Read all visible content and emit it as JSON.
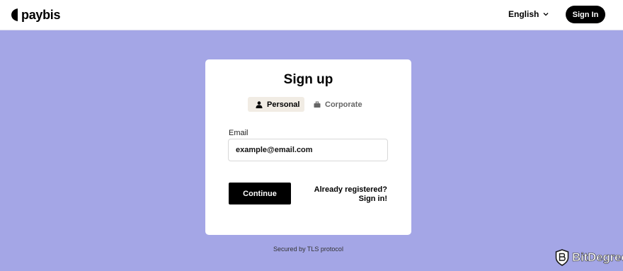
{
  "header": {
    "logo_text": "paybis",
    "language": "English",
    "sign_in_label": "Sign In"
  },
  "card": {
    "title": "Sign up",
    "tabs": [
      {
        "label": "Personal",
        "icon": "person-icon",
        "active": true
      },
      {
        "label": "Corporate",
        "icon": "briefcase-icon",
        "active": false
      }
    ],
    "email": {
      "label": "Email",
      "value": "example@email.com"
    },
    "continue_label": "Continue",
    "already_registered": "Already registered?",
    "sign_in_link": "Sign in!"
  },
  "footer": {
    "secured_text": "Secured by TLS protocol"
  },
  "watermark": {
    "text": "BitDegree"
  },
  "colors": {
    "background": "#a4a6e6",
    "primary_button": "#000000",
    "active_tab_bg": "#f1ece4",
    "card": "#ffffff"
  }
}
